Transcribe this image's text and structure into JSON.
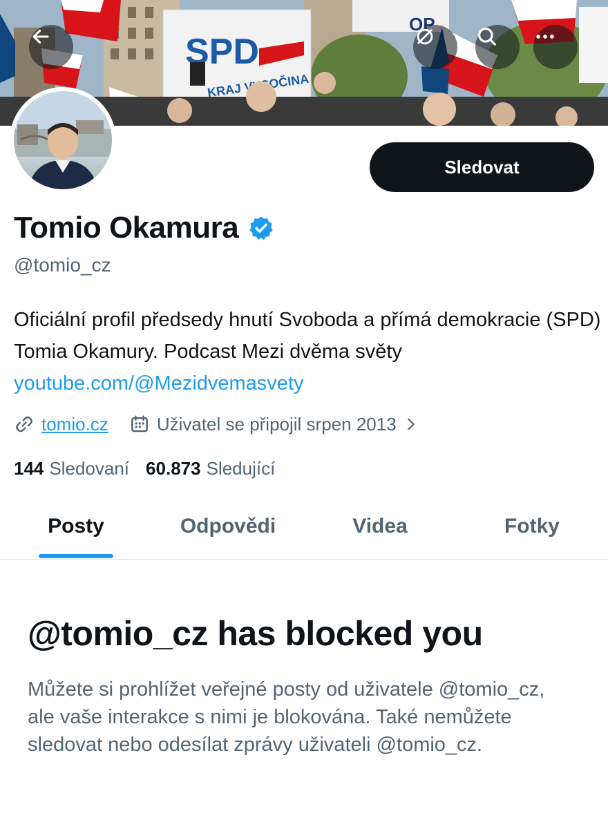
{
  "header": {
    "back_icon": "arrow-left-icon",
    "grok_icon": "circle-slash-icon",
    "search_icon": "search-icon",
    "more_icon": "more-horizontal-icon"
  },
  "banner": {
    "sign_text": "SPD",
    "sign_subtext": "KRAJ VYSOČINA"
  },
  "profile": {
    "name": "Tomio Okamura",
    "handle": "@tomio_cz",
    "follow_label": "Sledovat",
    "bio_text": "Oficiální profil předsedy hnutí Svoboda a přímá demokracie (SPD) Tomia Okamury. Podcast Mezi dvěma světy ",
    "bio_link": "youtube.com/@Mezidvemasvety",
    "website": "tomio.cz",
    "joined": "Uživatel se připojil srpen 2013",
    "following_count": "144",
    "following_label": "Sledovaní",
    "followers_count": "60.873",
    "followers_label": "Sledující"
  },
  "tabs": [
    {
      "label": "Posty",
      "active": true
    },
    {
      "label": "Odpovědi",
      "active": false
    },
    {
      "label": "Videa",
      "active": false
    },
    {
      "label": "Fotky",
      "active": false
    }
  ],
  "blocked": {
    "title": "@tomio_cz has blocked you",
    "text": "Můžete si prohlížet veřejné posty od uživatele @tomio_cz, ale vaše interakce s nimi je blokována. Také nemůžete sledovat nebo odesílat zprávy uživateli @tomio_cz."
  },
  "colors": {
    "accent": "#1d9bf0",
    "text_primary": "#0f1419",
    "text_secondary": "#536471",
    "button_bg": "#0f1419"
  }
}
